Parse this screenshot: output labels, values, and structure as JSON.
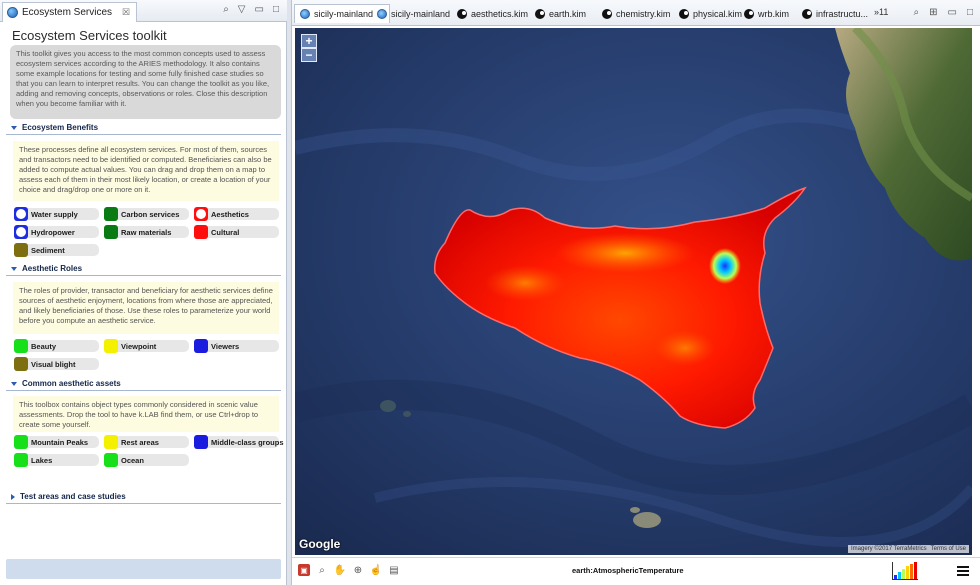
{
  "left_panel": {
    "tab_label": "Ecosystem Services",
    "tab_close": "☒",
    "title": "Ecosystem Services toolkit",
    "description": "This toolkit gives you access to the most common concepts used to assess ecosystem services according to the ARIES methodology. It also contains some example locations for testing and some fully finished case studies so that you can learn to interpret results. You can change the toolkit as you like, adding and removing concepts, observations or roles. Close this description when you become familiar with it.",
    "sections": [
      {
        "title": "Ecosystem Benefits",
        "note": "These processes define all ecosystem services. For most of them, sources and transactors need to be identified or computed. Beneficiaries can also be added to compute actual values. You can drag and drop them on a map to assess each of them in their most likely location, or create a location of your choice and drag/drop one or more on it.",
        "items": [
          {
            "label": "Water supply",
            "color": "#1c2ee0",
            "ring": true
          },
          {
            "label": "Carbon services",
            "color": "#0a7a12",
            "ring": false
          },
          {
            "label": "Aesthetics",
            "color": "#ff0e0e",
            "ring": true
          },
          {
            "label": "Hydropower",
            "color": "#1c2ee0",
            "ring": true
          },
          {
            "label": "Raw materials",
            "color": "#0a7a12",
            "ring": false
          },
          {
            "label": "Cultural",
            "color": "#ff0e0e",
            "ring": false
          },
          {
            "label": "Sediment",
            "color": "#7d6f10",
            "ring": false
          }
        ]
      },
      {
        "title": "Aesthetic Roles",
        "note": "The roles of provider, transactor and beneficiary for aesthetic services define sources of aesthetic enjoyment, locations from where those are appreciated, and likely beneficiaries of those. Use these roles to parameterize your world before you compute an aesthetic service.",
        "items": [
          {
            "label": "Beauty",
            "color": "#17e01b",
            "ring": false
          },
          {
            "label": "Viewpoint",
            "color": "#f3f000",
            "ring": false
          },
          {
            "label": "Viewers",
            "color": "#1a1ce0",
            "ring": false
          },
          {
            "label": "Visual blight",
            "color": "#7d6f10",
            "ring": false
          }
        ]
      },
      {
        "title": "Common aesthetic assets",
        "note": "This toolbox contains object types commonly considered in scenic value assessments. Drop the tool to have k.LAB find them, or use Ctrl+drop to create some yourself.",
        "items": [
          {
            "label": "Mountain Peaks",
            "color": "#17e01b",
            "ring": false
          },
          {
            "label": "Rest areas",
            "color": "#f3f000",
            "ring": false
          },
          {
            "label": "Middle-class groups",
            "color": "#1a1ce0",
            "ring": false
          },
          {
            "label": "Lakes",
            "color": "#17e01b",
            "ring": false
          },
          {
            "label": "Ocean",
            "color": "#17e01b",
            "ring": false
          }
        ]
      },
      {
        "title": "Test areas and case studies",
        "collapsed": true
      }
    ]
  },
  "editor": {
    "tabs": [
      {
        "label": "sicily-mainland",
        "icon": "globe-icon",
        "active": true,
        "close": "☒"
      },
      {
        "label": "sicily-mainland",
        "icon": "globe-icon",
        "active": false
      },
      {
        "label": "aesthetics.kim",
        "icon": "kim-file-icon",
        "active": false
      },
      {
        "label": "earth.kim",
        "icon": "kim-file-icon",
        "active": false
      },
      {
        "label": "chemistry.kim",
        "icon": "kim-file-icon",
        "active": false
      },
      {
        "label": "physical.kim",
        "icon": "kim-file-icon",
        "active": false
      },
      {
        "label": "wrb.kim",
        "icon": "kim-file-icon",
        "active": false
      },
      {
        "label": "infrastructu...",
        "icon": "kim-file-icon",
        "active": false
      }
    ],
    "overflow_label": "»11",
    "map": {
      "zoom_in": "+",
      "zoom_out": "−",
      "brand": "Google",
      "attribution": "Imagery ©2017 TerraMetrics",
      "terms": "Terms of Use"
    },
    "observation_label": "earth:AtmosphericTemperature"
  }
}
